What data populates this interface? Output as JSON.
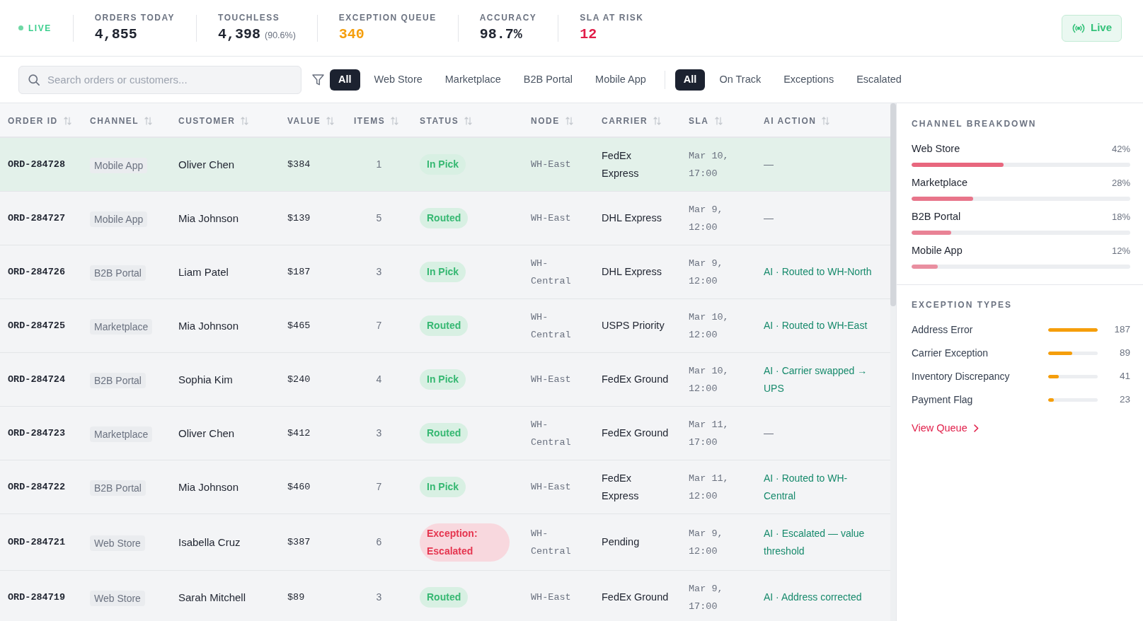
{
  "live_indicator": {
    "label": "LIVE"
  },
  "stats": [
    {
      "label": "ORDERS TODAY",
      "value": "4,855",
      "kind": "plain"
    },
    {
      "label": "TOUCHLESS",
      "value": "4,398",
      "note": "(90.6%)",
      "kind": "plain"
    },
    {
      "label": "EXCEPTION QUEUE",
      "value": "340",
      "kind": "warning"
    },
    {
      "label": "ACCURACY",
      "value": "98.7%",
      "kind": "plain"
    },
    {
      "label": "SLA AT RISK",
      "value": "12",
      "kind": "alert"
    }
  ],
  "live_button": {
    "label": "Live"
  },
  "search": {
    "placeholder": "Search orders or customers..."
  },
  "channel_filters": [
    {
      "label": "All",
      "selected": true
    },
    {
      "label": "Web Store",
      "selected": false
    },
    {
      "label": "Marketplace",
      "selected": false
    },
    {
      "label": "B2B Portal",
      "selected": false
    },
    {
      "label": "Mobile App",
      "selected": false
    }
  ],
  "status_filters": [
    {
      "label": "All",
      "selected": true
    },
    {
      "label": "On Track",
      "selected": false
    },
    {
      "label": "Exceptions",
      "selected": false
    },
    {
      "label": "Escalated",
      "selected": false
    }
  ],
  "table": {
    "columns": [
      "ORDER ID",
      "CHANNEL",
      "CUSTOMER",
      "VALUE",
      "ITEMS",
      "STATUS",
      "NODE",
      "CARRIER",
      "SLA",
      "AI ACTION"
    ],
    "rows": [
      {
        "selected": true,
        "order_id": "ORD-284728",
        "channel": "Mobile App",
        "customer": "Oliver Chen",
        "value": "$384",
        "items": "1",
        "status": {
          "label": "In Pick",
          "kind": "ok"
        },
        "node": "WH-East",
        "carrier": "FedEx Express",
        "sla": "Mar 10, 17:00",
        "ai_action": {
          "kind": "none",
          "text": "—"
        }
      },
      {
        "selected": false,
        "order_id": "ORD-284727",
        "channel": "Mobile App",
        "customer": "Mia Johnson",
        "value": "$139",
        "items": "5",
        "status": {
          "label": "Routed",
          "kind": "ok"
        },
        "node": "WH-East",
        "carrier": "DHL Express",
        "sla": "Mar 9, 12:00",
        "ai_action": {
          "kind": "none",
          "text": "—"
        }
      },
      {
        "selected": false,
        "order_id": "ORD-284726",
        "channel": "B2B Portal",
        "customer": "Liam Patel",
        "value": "$187",
        "items": "3",
        "status": {
          "label": "In Pick",
          "kind": "ok"
        },
        "node": "WH-Central",
        "carrier": "DHL Express",
        "sla": "Mar 9, 12:00",
        "ai_action": {
          "kind": "action",
          "text": "AI · Routed to WH-North"
        }
      },
      {
        "selected": false,
        "order_id": "ORD-284725",
        "channel": "Marketplace",
        "customer": "Mia Johnson",
        "value": "$465",
        "items": "7",
        "status": {
          "label": "Routed",
          "kind": "ok"
        },
        "node": "WH-Central",
        "carrier": "USPS Priority",
        "sla": "Mar 10, 12:00",
        "ai_action": {
          "kind": "action",
          "text": "AI · Routed to WH-East"
        }
      },
      {
        "selected": false,
        "order_id": "ORD-284724",
        "channel": "B2B Portal",
        "customer": "Sophia Kim",
        "value": "$240",
        "items": "4",
        "status": {
          "label": "In Pick",
          "kind": "ok"
        },
        "node": "WH-East",
        "carrier": "FedEx Ground",
        "sla": "Mar 10, 12:00",
        "ai_action": {
          "kind": "action",
          "text": "AI · Carrier swapped → UPS"
        }
      },
      {
        "selected": false,
        "order_id": "ORD-284723",
        "channel": "Marketplace",
        "customer": "Oliver Chen",
        "value": "$412",
        "items": "3",
        "status": {
          "label": "Routed",
          "kind": "ok"
        },
        "node": "WH-Central",
        "carrier": "FedEx Ground",
        "sla": "Mar 11, 17:00",
        "ai_action": {
          "kind": "none",
          "text": "—"
        }
      },
      {
        "selected": false,
        "order_id": "ORD-284722",
        "channel": "B2B Portal",
        "customer": "Mia Johnson",
        "value": "$460",
        "items": "7",
        "status": {
          "label": "In Pick",
          "kind": "ok"
        },
        "node": "WH-East",
        "carrier": "FedEx Express",
        "sla": "Mar 11, 12:00",
        "ai_action": {
          "kind": "action",
          "text": "AI · Routed to WH-Central"
        }
      },
      {
        "selected": false,
        "order_id": "ORD-284721",
        "channel": "Web Store",
        "customer": "Isabella Cruz",
        "value": "$387",
        "items": "6",
        "status": {
          "label": "Exception: Escalated",
          "kind": "exception"
        },
        "node": "WH-Central",
        "carrier": "Pending",
        "sla": "Mar 9, 12:00",
        "ai_action": {
          "kind": "action",
          "text": "AI · Escalated — value threshold"
        }
      },
      {
        "selected": false,
        "order_id": "ORD-284719",
        "channel": "Web Store",
        "customer": "Sarah Mitchell",
        "value": "$89",
        "items": "3",
        "status": {
          "label": "Routed",
          "kind": "ok"
        },
        "node": "WH-East",
        "carrier": "FedEx Ground",
        "sla": "Mar 9, 17:00",
        "ai_action": {
          "kind": "action",
          "text": "AI · Address corrected"
        }
      }
    ]
  },
  "sidebar": {
    "channel_breakdown": {
      "title": "CHANNEL BREAKDOWN",
      "items": [
        {
          "name": "Web Store",
          "reading": "42%",
          "level": 0.42
        },
        {
          "name": "Marketplace",
          "reading": "28%",
          "level": 0.28
        },
        {
          "name": "B2B Portal",
          "reading": "18%",
          "level": 0.18
        },
        {
          "name": "Mobile App",
          "reading": "12%",
          "level": 0.12
        }
      ]
    },
    "exception_types": {
      "title": "EXCEPTION TYPES",
      "items": [
        {
          "name": "Address Error",
          "count": "187",
          "level": 1.0
        },
        {
          "name": "Carrier Exception",
          "count": "89",
          "level": 0.48
        },
        {
          "name": "Inventory Discrepancy",
          "count": "41",
          "level": 0.22
        },
        {
          "name": "Payment Flag",
          "count": "23",
          "level": 0.12
        }
      ],
      "link": "View Queue"
    }
  }
}
